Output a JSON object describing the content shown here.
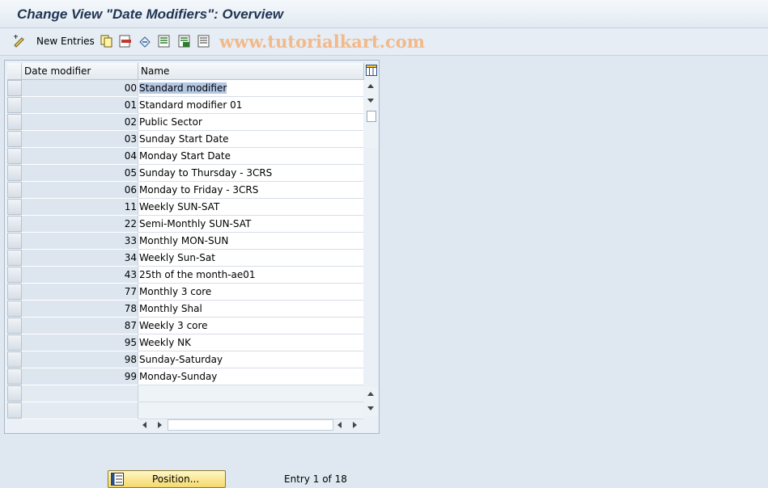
{
  "window": {
    "title": "Change View \"Date Modifiers\": Overview"
  },
  "toolbar": {
    "new_entries_label": "New Entries",
    "icons": [
      "change-display-icon",
      "copy-icon",
      "delete-icon",
      "undo-icon",
      "select-all-icon",
      "select-block-icon",
      "deselect-all-icon"
    ]
  },
  "watermark": "www.tutorialkart.com",
  "table": {
    "columns": [
      "Date modifier",
      "Name"
    ],
    "rows": [
      {
        "code": "00",
        "name": "Standard modifier"
      },
      {
        "code": "01",
        "name": "Standard modifier 01"
      },
      {
        "code": "02",
        "name": "Public Sector"
      },
      {
        "code": "03",
        "name": "Sunday Start Date"
      },
      {
        "code": "04",
        "name": "Monday Start Date"
      },
      {
        "code": "05",
        "name": "Sunday to Thursday - 3CRS"
      },
      {
        "code": "06",
        "name": "Monday to Friday - 3CRS"
      },
      {
        "code": "11",
        "name": "Weekly SUN-SAT"
      },
      {
        "code": "22",
        "name": "Semi-Monthly SUN-SAT"
      },
      {
        "code": "33",
        "name": "Monthly MON-SUN"
      },
      {
        "code": "34",
        "name": "Weekly Sun-Sat"
      },
      {
        "code": "43",
        "name": "25th of the month-ae01"
      },
      {
        "code": "77",
        "name": "Monthly 3 core"
      },
      {
        "code": "78",
        "name": "Monthly Shal"
      },
      {
        "code": "87",
        "name": "Weekly 3 core"
      },
      {
        "code": "95",
        "name": "Weekly NK"
      },
      {
        "code": "98",
        "name": "Sunday-Saturday"
      },
      {
        "code": "99",
        "name": "Monday-Sunday"
      }
    ],
    "empty_rows": 2
  },
  "footer": {
    "position_button_label": "Position...",
    "entry_text": "Entry 1 of 18"
  }
}
